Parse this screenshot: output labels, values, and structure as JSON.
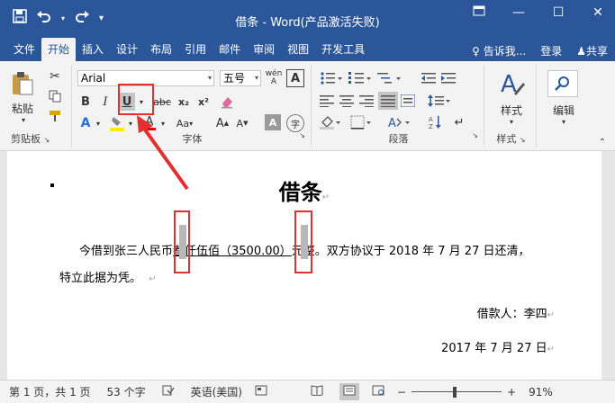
{
  "app": {
    "title": "借条 - Word(产品激活失败)",
    "qat": [
      "save-icon",
      "undo-icon",
      "redo-icon",
      "customize-icon"
    ],
    "window_buttons": [
      "ribbon-display-icon",
      "minimize-icon",
      "restore-icon",
      "close-icon"
    ]
  },
  "tabs": [
    "文件",
    "开始",
    "插入",
    "设计",
    "布局",
    "引用",
    "邮件",
    "审阅",
    "视图",
    "开发工具"
  ],
  "active_tab": "开始",
  "tell_me": "告诉我...",
  "login": "登录",
  "share": "共享",
  "ribbon": {
    "clipboard": {
      "label": "剪贴板",
      "paste": "粘贴"
    },
    "font": {
      "label": "字体",
      "font_name": "Arial",
      "font_size": "五号",
      "bold": "B",
      "italic": "I",
      "underline": "U",
      "strike": "abc",
      "sub": "x₂",
      "sup": "x²",
      "case": "Aa",
      "grow": "A",
      "shrink": "A",
      "phonetic": "wén",
      "char_border": "A",
      "char_shading": "A",
      "enclose": "字",
      "font_color": "A",
      "effects": "A",
      "highlight": "ab"
    },
    "paragraph": {
      "label": "段落"
    },
    "styles": {
      "label": "样式",
      "button": "样式"
    },
    "editing": {
      "button": "编辑"
    },
    "colors": {
      "accent": "#2b579a",
      "ribbon_bg": "#f3f3f3",
      "annotation_red": "#e03030"
    }
  },
  "document": {
    "title": "借条",
    "body_line1_prefix": "今借到张三人民币",
    "body_underlined": "叁仟伍佰（3500.00）",
    "body_line1_suffix": "元整。双方协议于 2018 年 7 月 27 日还清，",
    "body_line2": "特立此据为凭。",
    "borrower": "借款人：李四",
    "date": "2017 年 7 月 27 日"
  },
  "status": {
    "page": "第 1 页，共 1 页",
    "words": "53 个字",
    "language": "英语(美国)",
    "zoom": "91%"
  }
}
